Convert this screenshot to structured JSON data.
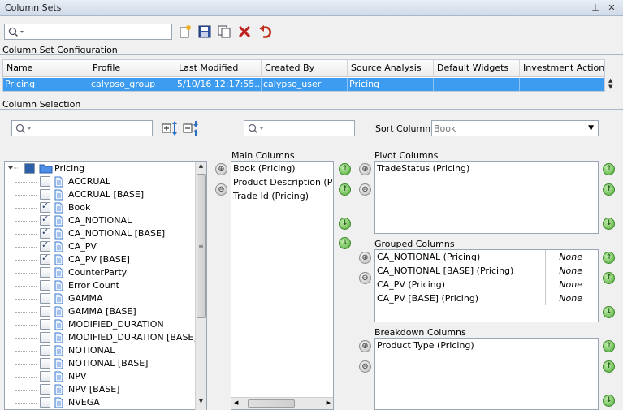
{
  "window": {
    "title": "Column Sets",
    "pin_glyph": "⊥",
    "close_glyph": "✕"
  },
  "search": {
    "value": "",
    "placeholder": ""
  },
  "toolbar": {
    "new": "new-icon",
    "save": "save-icon",
    "copy": "copy-icon",
    "delete": "delete-icon",
    "undo": "undo-icon"
  },
  "config": {
    "label": "Column Set Configuration",
    "columns": [
      "Name",
      "Profile",
      "Last Modified",
      "Created By",
      "Source Analysis",
      "Default Widgets",
      "Investment Actions"
    ],
    "rows": [
      {
        "name": "Pricing",
        "profile": "calypso_group",
        "last_modified": "5/10/16 12:17:55....",
        "created_by": "calypso_user",
        "source_analysis": "Pricing",
        "default_widgets": "",
        "investment_actions": ""
      }
    ]
  },
  "selection": {
    "label": "Column Selection",
    "tree_search": {
      "value": "",
      "placeholder": ""
    },
    "main_search": {
      "value": "",
      "placeholder": ""
    },
    "sort_column_label": "Sort Column",
    "sort_column_value": "Book",
    "tree": {
      "root": "Pricing",
      "items": [
        {
          "label": "ACCRUAL",
          "checked": false
        },
        {
          "label": "ACCRUAL [BASE]",
          "checked": false
        },
        {
          "label": "Book",
          "checked": true
        },
        {
          "label": "CA_NOTIONAL",
          "checked": true
        },
        {
          "label": "CA_NOTIONAL [BASE]",
          "checked": true
        },
        {
          "label": "CA_PV",
          "checked": true
        },
        {
          "label": "CA_PV [BASE]",
          "checked": true
        },
        {
          "label": "CounterParty",
          "checked": false
        },
        {
          "label": "Error Count",
          "checked": false
        },
        {
          "label": "GAMMA",
          "checked": false
        },
        {
          "label": "GAMMA [BASE]",
          "checked": false
        },
        {
          "label": "MODIFIED_DURATION",
          "checked": false
        },
        {
          "label": "MODIFIED_DURATION [BASE]",
          "checked": false
        },
        {
          "label": "NOTIONAL",
          "checked": false
        },
        {
          "label": "NOTIONAL [BASE]",
          "checked": false
        },
        {
          "label": "NPV",
          "checked": false
        },
        {
          "label": "NPV [BASE]",
          "checked": false
        },
        {
          "label": "NVEGA",
          "checked": false
        }
      ]
    },
    "main_columns": {
      "label": "Main Columns",
      "items": [
        "Book (Pricing)",
        "Product Description (Pricing)",
        "Trade Id (Pricing)"
      ]
    },
    "pivot_columns": {
      "label": "Pivot Columns",
      "items": [
        "TradeStatus (Pricing)"
      ]
    },
    "grouped_columns": {
      "label": "Grouped Columns",
      "items": [
        {
          "label": "CA_NOTIONAL (Pricing)",
          "agg": "None"
        },
        {
          "label": "CA_NOTIONAL [BASE] (Pricing)",
          "agg": "None"
        },
        {
          "label": "CA_PV (Pricing)",
          "agg": "None"
        },
        {
          "label": "CA_PV [BASE] (Pricing)",
          "agg": "None"
        }
      ]
    },
    "breakdown_columns": {
      "label": "Breakdown Columns",
      "items": [
        "Product Type (Pricing)"
      ]
    }
  },
  "buttons": {
    "add": "⊕",
    "remove": "⊖",
    "top": "⇑",
    "up": "↑",
    "down": "↓",
    "bottom": "⇓"
  }
}
